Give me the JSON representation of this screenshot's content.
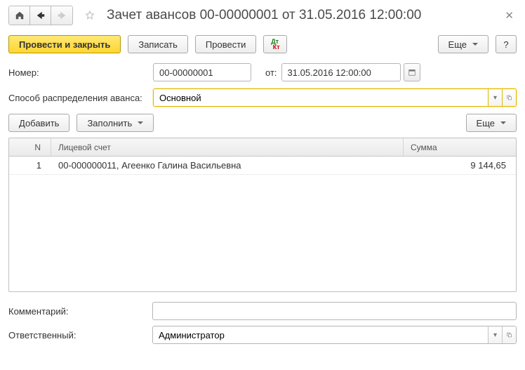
{
  "header": {
    "title": "Зачет авансов 00-00000001 от 31.05.2016 12:00:00"
  },
  "toolbar": {
    "post_and_close": "Провести и закрыть",
    "save": "Записать",
    "post": "Провести",
    "more": "Еще",
    "help": "?"
  },
  "form": {
    "number_label": "Номер:",
    "number_value": "00-00000001",
    "date_label": "от:",
    "date_value": "31.05.2016 12:00:00",
    "alloc_label": "Способ распределения аванса:",
    "alloc_value": "Основной"
  },
  "tablebar": {
    "add": "Добавить",
    "fill": "Заполнить",
    "more": "Еще"
  },
  "table": {
    "headers": {
      "n": "N",
      "account": "Лицевой счет",
      "sum": "Сумма"
    },
    "rows": [
      {
        "n": "1",
        "account": "00-000000011, Агеенко Галина Васильевна",
        "sum": "9 144,65"
      }
    ]
  },
  "footer": {
    "comment_label": "Комментарий:",
    "comment_value": "",
    "responsible_label": "Ответственный:",
    "responsible_value": "Администратор"
  }
}
